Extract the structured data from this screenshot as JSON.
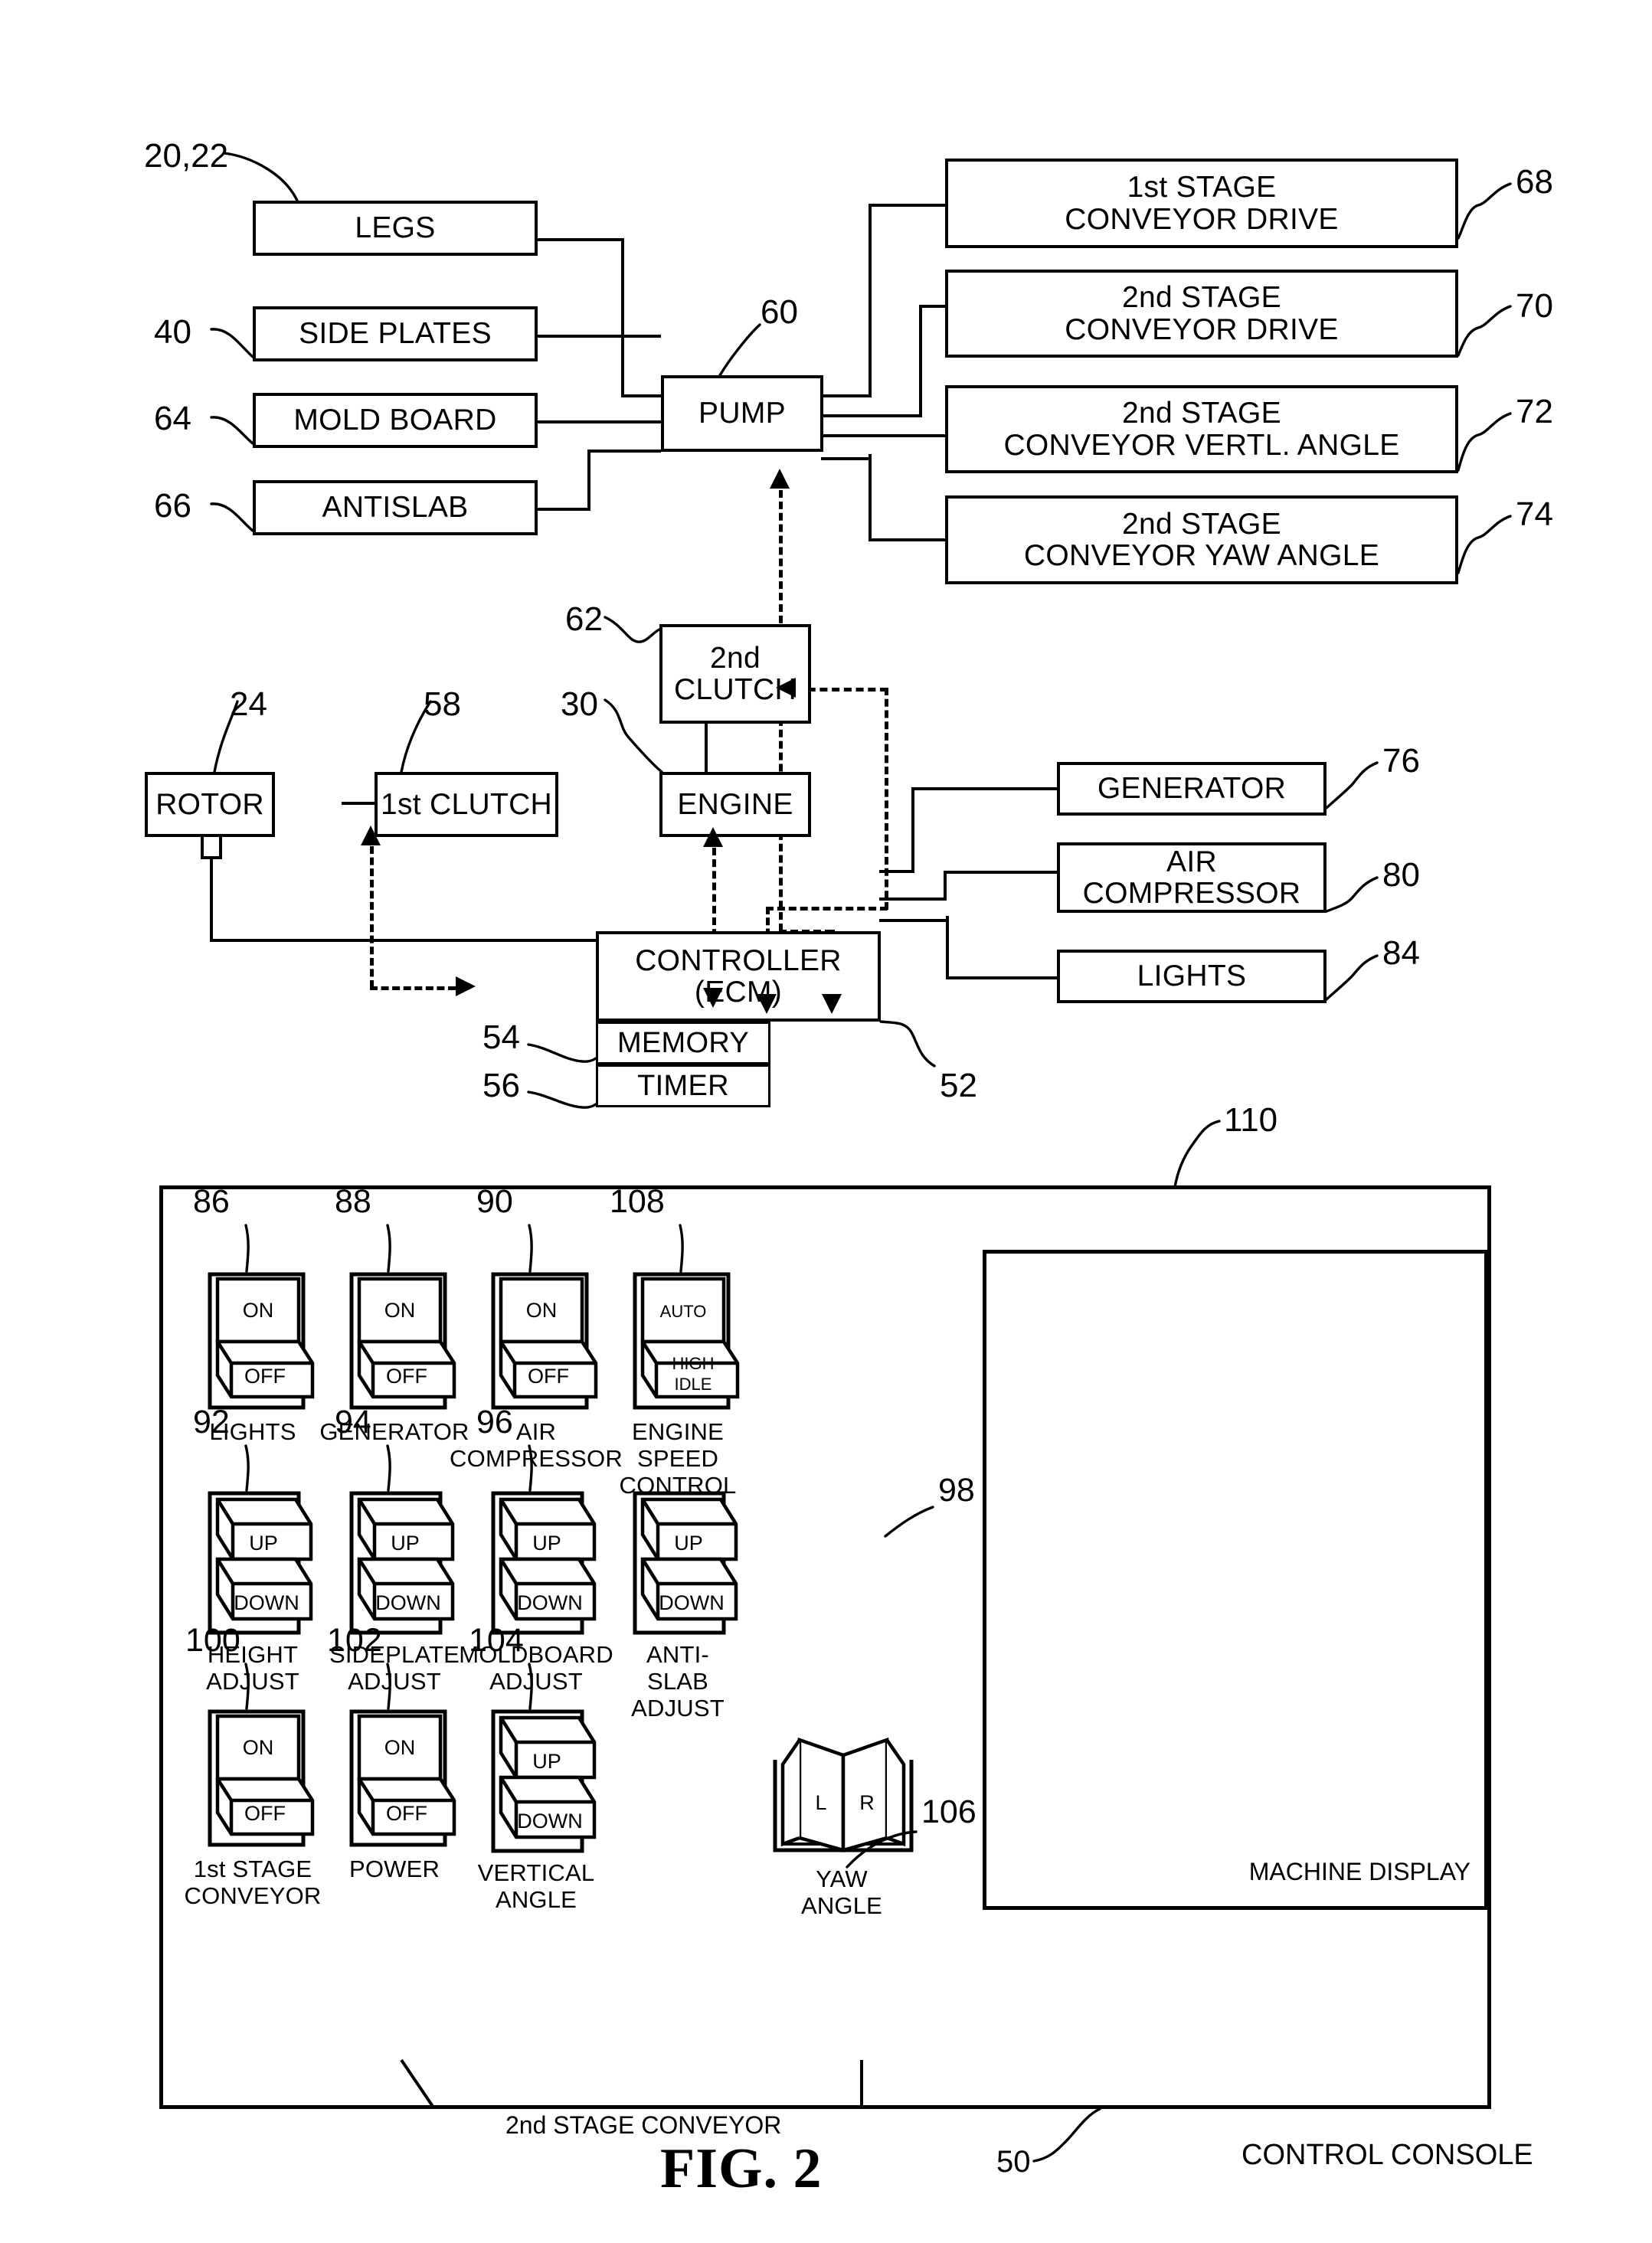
{
  "figure": {
    "caption": "FIG. 2",
    "console_caption": "CONTROL CONSOLE",
    "console_ref": "50",
    "panel_ref": "110"
  },
  "blocks": {
    "legs": {
      "label": "LEGS",
      "ref": "20,22"
    },
    "side_plates": {
      "label": "SIDE PLATES",
      "ref": "40"
    },
    "mold_board": {
      "label": "MOLD BOARD",
      "ref": "64"
    },
    "antislab": {
      "label": "ANTISLAB",
      "ref": "66"
    },
    "pump": {
      "label": "PUMP",
      "ref": "60"
    },
    "conveyor_1_drive": {
      "label": "1st STAGE\nCONVEYOR DRIVE",
      "ref": "68"
    },
    "conveyor_2_drive": {
      "label": "2nd  STAGE\nCONVEYOR DRIVE",
      "ref": "70"
    },
    "conveyor_2_vert": {
      "label": "2nd STAGE\nCONVEYOR VERTL. ANGLE",
      "ref": "72"
    },
    "conveyor_2_yaw": {
      "label": "2nd STAGE\nCONVEYOR YAW ANGLE",
      "ref": "74"
    },
    "clutch_2": {
      "label": "2nd\nCLUTCH",
      "ref": "62"
    },
    "rotor": {
      "label": "ROTOR",
      "ref": "24"
    },
    "clutch_1": {
      "label": "1st CLUTCH",
      "ref": "58"
    },
    "engine": {
      "label": "ENGINE",
      "ref": "30"
    },
    "controller": {
      "label": "CONTROLLER\n(ECM)",
      "ref": "52"
    },
    "memory": {
      "label": "MEMORY",
      "ref": "54"
    },
    "timer": {
      "label": "TIMER",
      "ref": "56"
    },
    "generator": {
      "label": "GENERATOR",
      "ref": "76"
    },
    "air_compressor": {
      "label": "AIR\nCOMPRESSOR",
      "ref": "80"
    },
    "lights": {
      "label": "LIGHTS",
      "ref": "84"
    }
  },
  "console": {
    "machine_display_label": "MACHINE DISPLAY",
    "group_label_2nd_stage": "2nd STAGE  CONVEYOR",
    "switches": [
      {
        "ref": "86",
        "type": "onoff",
        "top": "ON",
        "bottom": "OFF",
        "label": "LIGHTS"
      },
      {
        "ref": "88",
        "type": "onoff",
        "top": "ON",
        "bottom": "OFF",
        "label": "GENERATOR"
      },
      {
        "ref": "90",
        "type": "onoff",
        "top": "ON",
        "bottom": "OFF",
        "label": "AIR\nCOMPRESSOR"
      },
      {
        "ref": "108",
        "type": "onoff",
        "top": "AUTO",
        "bottom": "HIGH\nIDLE",
        "label": "ENGINE\nSPEED\nCONTROL"
      },
      {
        "ref": "92",
        "type": "updown",
        "top": "UP",
        "bottom": "DOWN",
        "label": "HEIGHT\nADJUST"
      },
      {
        "ref": "94",
        "type": "updown",
        "top": "UP",
        "bottom": "DOWN",
        "label": "SIDEPLATE\nADJUST"
      },
      {
        "ref": "96",
        "type": "updown",
        "top": "UP",
        "bottom": "DOWN",
        "label": "MOLDBOARD\nADJUST"
      },
      {
        "ref": "98",
        "type": "updown",
        "top": "UP",
        "bottom": "DOWN",
        "label": "ANTI-SLAB\nADJUST"
      },
      {
        "ref": "100",
        "type": "onoff",
        "top": "ON",
        "bottom": "OFF",
        "label": "1st STAGE\nCONVEYOR"
      },
      {
        "ref": "102",
        "type": "onoff",
        "top": "ON",
        "bottom": "OFF",
        "label": "POWER"
      },
      {
        "ref": "104",
        "type": "updown",
        "top": "UP",
        "bottom": "DOWN",
        "label": "VERTICAL\nANGLE"
      },
      {
        "ref": "106",
        "type": "lr",
        "left": "L",
        "right": "R",
        "label": "YAW ANGLE"
      }
    ]
  }
}
